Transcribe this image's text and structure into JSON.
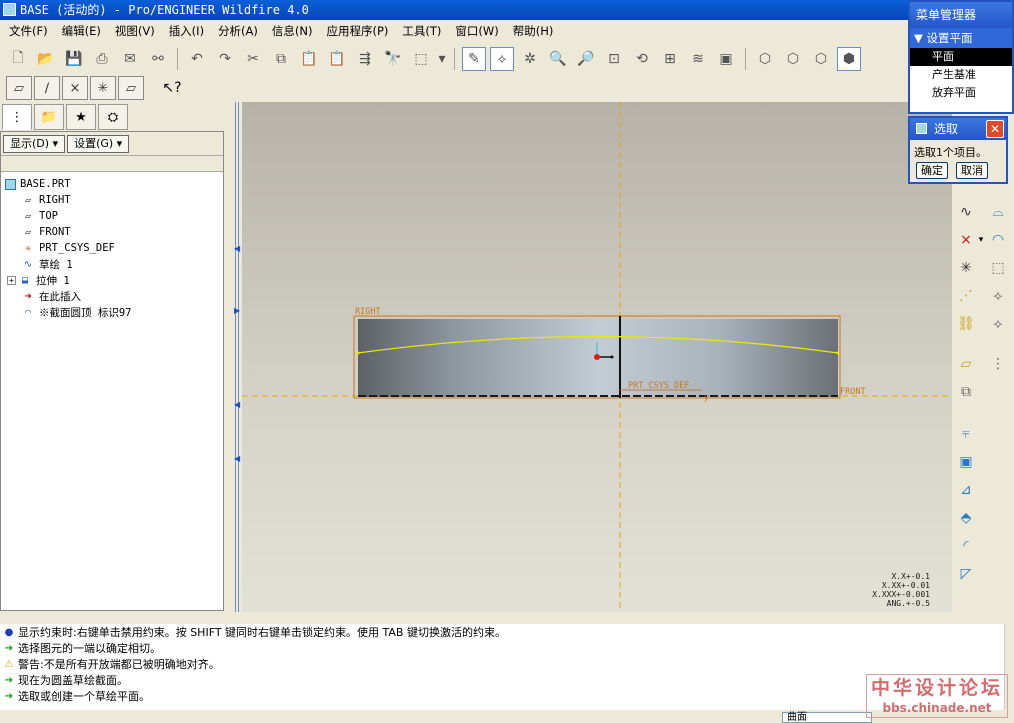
{
  "window": {
    "title": "BASE (活动的) - Pro/ENGINEER Wildfire 4.0"
  },
  "menubar": [
    "文件(F)",
    "编辑(E)",
    "视图(V)",
    "插入(I)",
    "分析(A)",
    "信息(N)",
    "应用程序(P)",
    "工具(T)",
    "窗口(W)",
    "帮助(H)"
  ],
  "left_panel": {
    "display_button": "显示(D) ▾",
    "settings_button": "设置(G) ▾",
    "tree": [
      {
        "label": "BASE.PRT",
        "icon": "part-icon"
      },
      {
        "label": "RIGHT",
        "icon": "datum-plane-icon"
      },
      {
        "label": "TOP",
        "icon": "datum-plane-icon"
      },
      {
        "label": "FRONT",
        "icon": "datum-plane-icon"
      },
      {
        "label": "PRT_CSYS_DEF",
        "icon": "csys-icon"
      },
      {
        "label": "草绘 1",
        "icon": "sketch-icon"
      },
      {
        "label": "拉伸 1",
        "icon": "extrude-icon"
      },
      {
        "label": "在此插入",
        "icon": "insert-arrow-icon"
      },
      {
        "label": "※截面圆顶 标识97",
        "icon": "dome-icon"
      }
    ]
  },
  "graphics": {
    "datum_labels": {
      "right": "RIGHT",
      "front": "FRONT",
      "csys": "PRT_CSYS_DEF"
    },
    "tolerances": [
      "X.X+-0.1",
      "X.XX+-0.01",
      "X.XXX+-0.001",
      "ANG.+-0.5"
    ]
  },
  "menu_manager": {
    "title": "菜单管理器",
    "submenu": "设置平面",
    "items": [
      "平面",
      "产生基准",
      "放弃平面"
    ],
    "selected_index": 0
  },
  "select_dialog": {
    "title": "选取",
    "message": "选取1个项目。",
    "ok_label": "确定",
    "cancel_label": "取消"
  },
  "messages": [
    {
      "icon": "info-dot-icon",
      "text": "显示约束时:右键单击禁用约束。按 SHIFT 键同时右键单击锁定约束。使用 TAB 键切换激活的约束。"
    },
    {
      "icon": "prompt-arrow-icon",
      "text": "选择图元的一端以确定相切。"
    },
    {
      "icon": "warning-icon",
      "text": "警告:不是所有开放端都已被明确地对齐。"
    },
    {
      "icon": "prompt-arrow-icon",
      "text": "现在为圆盖草绘截面。"
    },
    {
      "icon": "prompt-arrow-icon",
      "text": "选取或创建一个草绘平面。"
    }
  ],
  "statusbar": {
    "filter": "曲面"
  },
  "watermark": {
    "main": "中华设计论坛",
    "sub": "bbs.chinade.net"
  },
  "colors": {
    "title_blue": "#0a5fd8",
    "datum_orange": "#c8961e",
    "sketch_yellow": "#e8e800"
  }
}
